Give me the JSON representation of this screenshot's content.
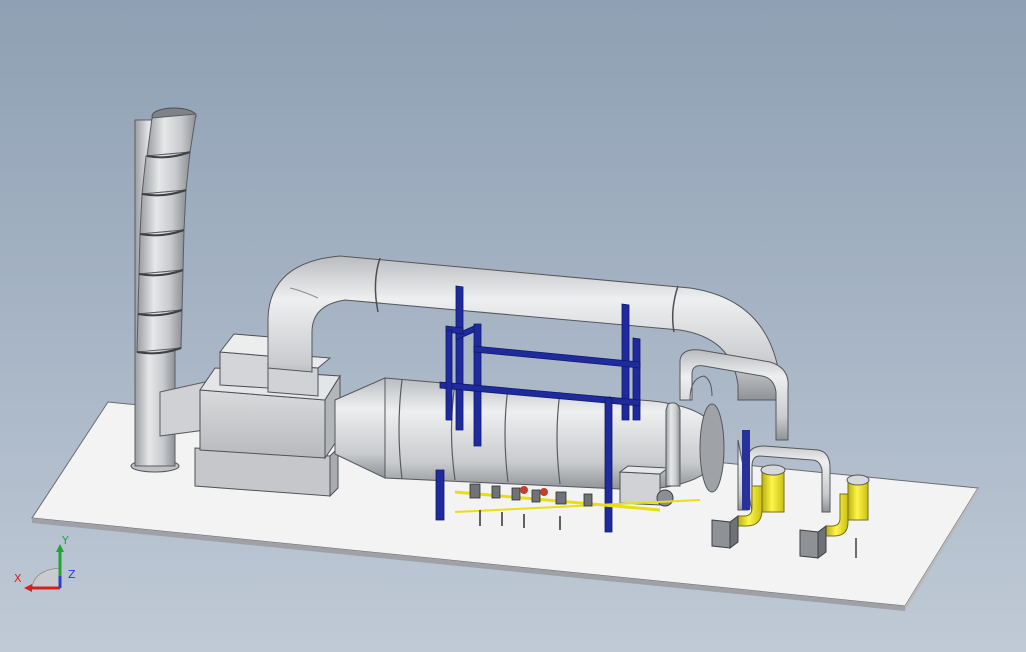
{
  "viewport": {
    "background_top": "#8fa0b4",
    "background_bottom": "#c0cad6"
  },
  "model": {
    "components": [
      "skid-base",
      "exhaust-stack",
      "filter-housing",
      "oxidizer-chamber",
      "overhead-duct",
      "support-frame",
      "burner-train",
      "blowers"
    ],
    "colors": {
      "steel": "#d4d6d9",
      "frame": "#1f2a9c",
      "pipe_highlight": "#f0e81a",
      "base": "#f2f2f2"
    }
  },
  "triad": {
    "x_label": "X",
    "y_label": "Y",
    "z_label": "Z",
    "x_color": "#d42020",
    "y_color": "#22a33a",
    "z_color": "#2a3fd0"
  }
}
